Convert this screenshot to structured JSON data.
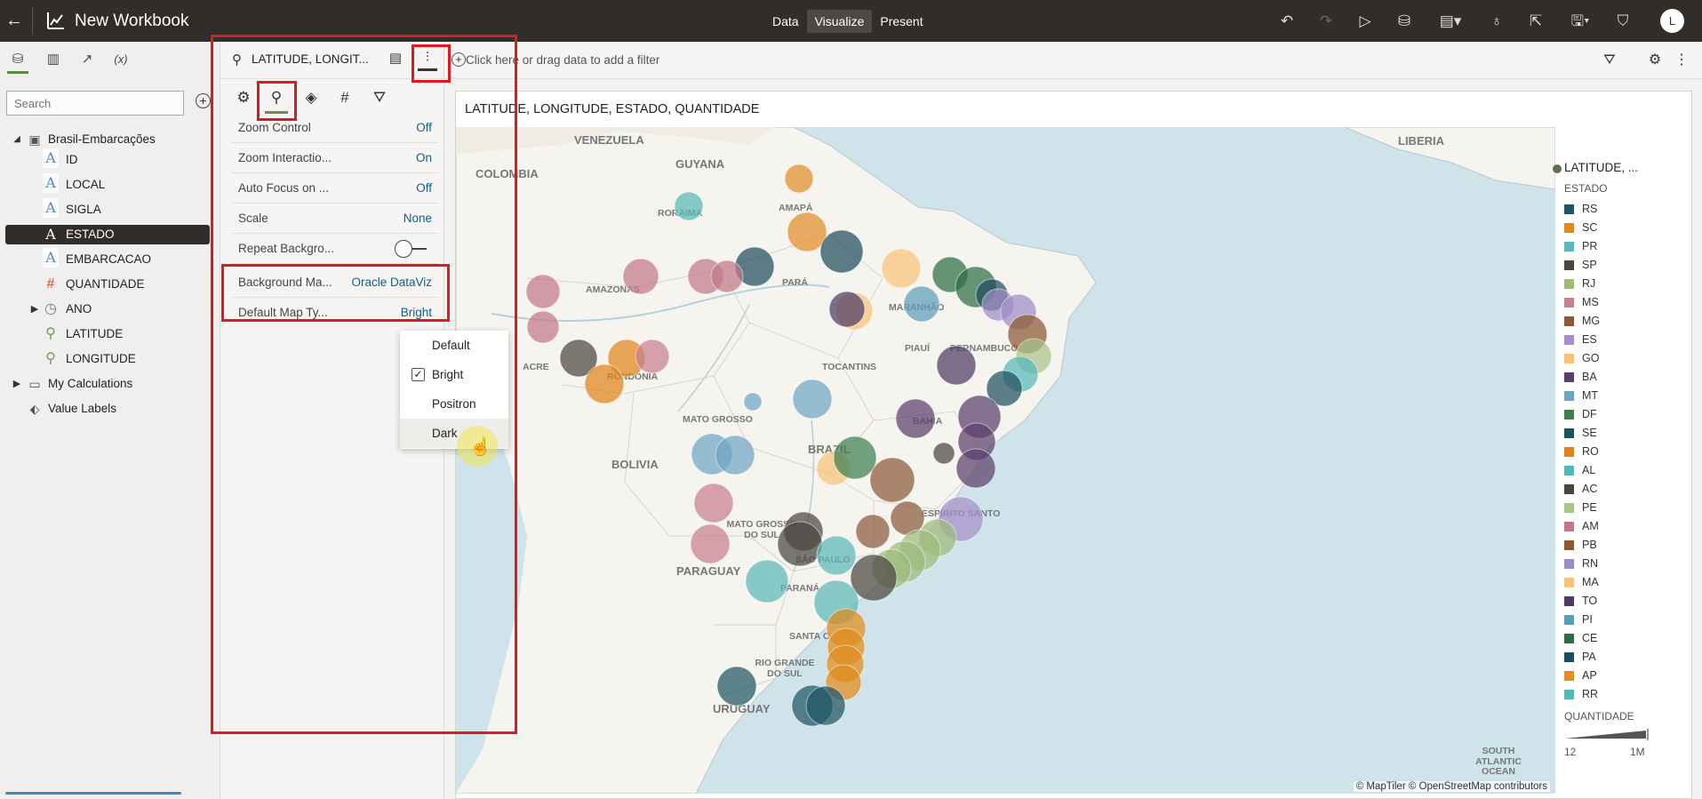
{
  "app": {
    "title": "New Workbook",
    "modes": [
      "Data",
      "Visualize",
      "Present"
    ],
    "active_mode": "Visualize",
    "user_initial": "L"
  },
  "data_panel": {
    "search_placeholder": "Search",
    "dataset": "Brasil-Embarcações",
    "columns": [
      {
        "label": "ID",
        "kind": "attribute"
      },
      {
        "label": "LOCAL",
        "kind": "attribute"
      },
      {
        "label": "SIGLA",
        "kind": "attribute"
      },
      {
        "label": "ESTADO",
        "kind": "attribute",
        "selected": true
      },
      {
        "label": "EMBARCACAO",
        "kind": "attribute"
      },
      {
        "label": "QUANTIDADE",
        "kind": "measure"
      },
      {
        "label": "ANO",
        "kind": "time"
      },
      {
        "label": "LATITUDE",
        "kind": "geo"
      },
      {
        "label": "LONGITUDE",
        "kind": "geo"
      }
    ],
    "extra": [
      "My Calculations",
      "Value Labels"
    ]
  },
  "properties": {
    "header_title": "LATITUDE, LONGIT...",
    "rows": [
      {
        "label": "Zoom Control",
        "value": "Off"
      },
      {
        "label": "Zoom Interactio...",
        "value": "On"
      },
      {
        "label": "Auto Focus on ...",
        "value": "Off"
      },
      {
        "label": "Scale",
        "value": "None"
      },
      {
        "label": "Repeat Backgro...",
        "value": ""
      },
      {
        "label": "Background Ma...",
        "value": "Oracle DataViz"
      },
      {
        "label": "Default Map Ty...",
        "value": "Bright"
      }
    ],
    "dropdown": [
      {
        "label": "Default"
      },
      {
        "label": "Bright",
        "checked": true
      },
      {
        "label": "Positron"
      },
      {
        "label": "Dark",
        "hover": true
      }
    ]
  },
  "filterbar": {
    "placeholder": "Click here or drag data to add a filter"
  },
  "viz": {
    "title": "LATITUDE, LONGITUDE, ESTADO, QUANTIDADE",
    "attribution": "© MapTiler © OpenStreetMap contributors",
    "map_labels": [
      "VENEZUELA",
      "COLOMBIA",
      "GUYANA",
      "LIBERIA",
      "AMAPÁ",
      "RORAIMA",
      "PARÁ",
      "AMAZONAS",
      "MARANHÃO",
      "ACRE",
      "RONDÔNIA",
      "TOCANTINS",
      "PIAUÍ",
      "PERNAMBUCO",
      "MATO GROSSO",
      "BAHIA",
      "BRAZIL",
      "BOLIVIA",
      "MATO GROSSO DO SUL",
      "ESPÍRITO SANTO",
      "SÃO PAULO",
      "PARAGUAY",
      "PARANÁ",
      "SANTA C",
      "RIO GRANDE DO SUL",
      "URUGUAY",
      "SOUTH ATLANTIC OCEAN"
    ]
  },
  "legend": {
    "title": "LATITUDE, ...",
    "color_title": "ESTADO",
    "items": [
      {
        "label": "RS",
        "color": "#1f5564"
      },
      {
        "label": "SC",
        "color": "#e08a1a"
      },
      {
        "label": "PR",
        "color": "#5cb8b8"
      },
      {
        "label": "SP",
        "color": "#4a4540"
      },
      {
        "label": "RJ",
        "color": "#9dbb7c"
      },
      {
        "label": "MS",
        "color": "#c7808f"
      },
      {
        "label": "MG",
        "color": "#8a5a3b"
      },
      {
        "label": "ES",
        "color": "#a48fcb"
      },
      {
        "label": "GO",
        "color": "#f6c376"
      },
      {
        "label": "BA",
        "color": "#5a3f6e"
      },
      {
        "label": "MT",
        "color": "#6ea5c3"
      },
      {
        "label": "DF",
        "color": "#3f7f4f"
      },
      {
        "label": "SE",
        "color": "#1f5060"
      },
      {
        "label": "RO",
        "color": "#e0841c"
      },
      {
        "label": "AL",
        "color": "#54b8b8"
      },
      {
        "label": "AC",
        "color": "#4a4540"
      },
      {
        "label": "PE",
        "color": "#a8c58a"
      },
      {
        "label": "AM",
        "color": "#c17888"
      },
      {
        "label": "PB",
        "color": "#8a5833"
      },
      {
        "label": "RN",
        "color": "#9e8cc8"
      },
      {
        "label": "MA",
        "color": "#f7c27c"
      },
      {
        "label": "TO",
        "color": "#4e3a64"
      },
      {
        "label": "PI",
        "color": "#5e9cba"
      },
      {
        "label": "CE",
        "color": "#2e6e44"
      },
      {
        "label": "PA",
        "color": "#1e4e5c"
      },
      {
        "label": "AP",
        "color": "#e08f28"
      },
      {
        "label": "RR",
        "color": "#57b8b8"
      }
    ],
    "size_title": "QUANTIDADE",
    "size_min": "12",
    "size_max": "1M"
  }
}
